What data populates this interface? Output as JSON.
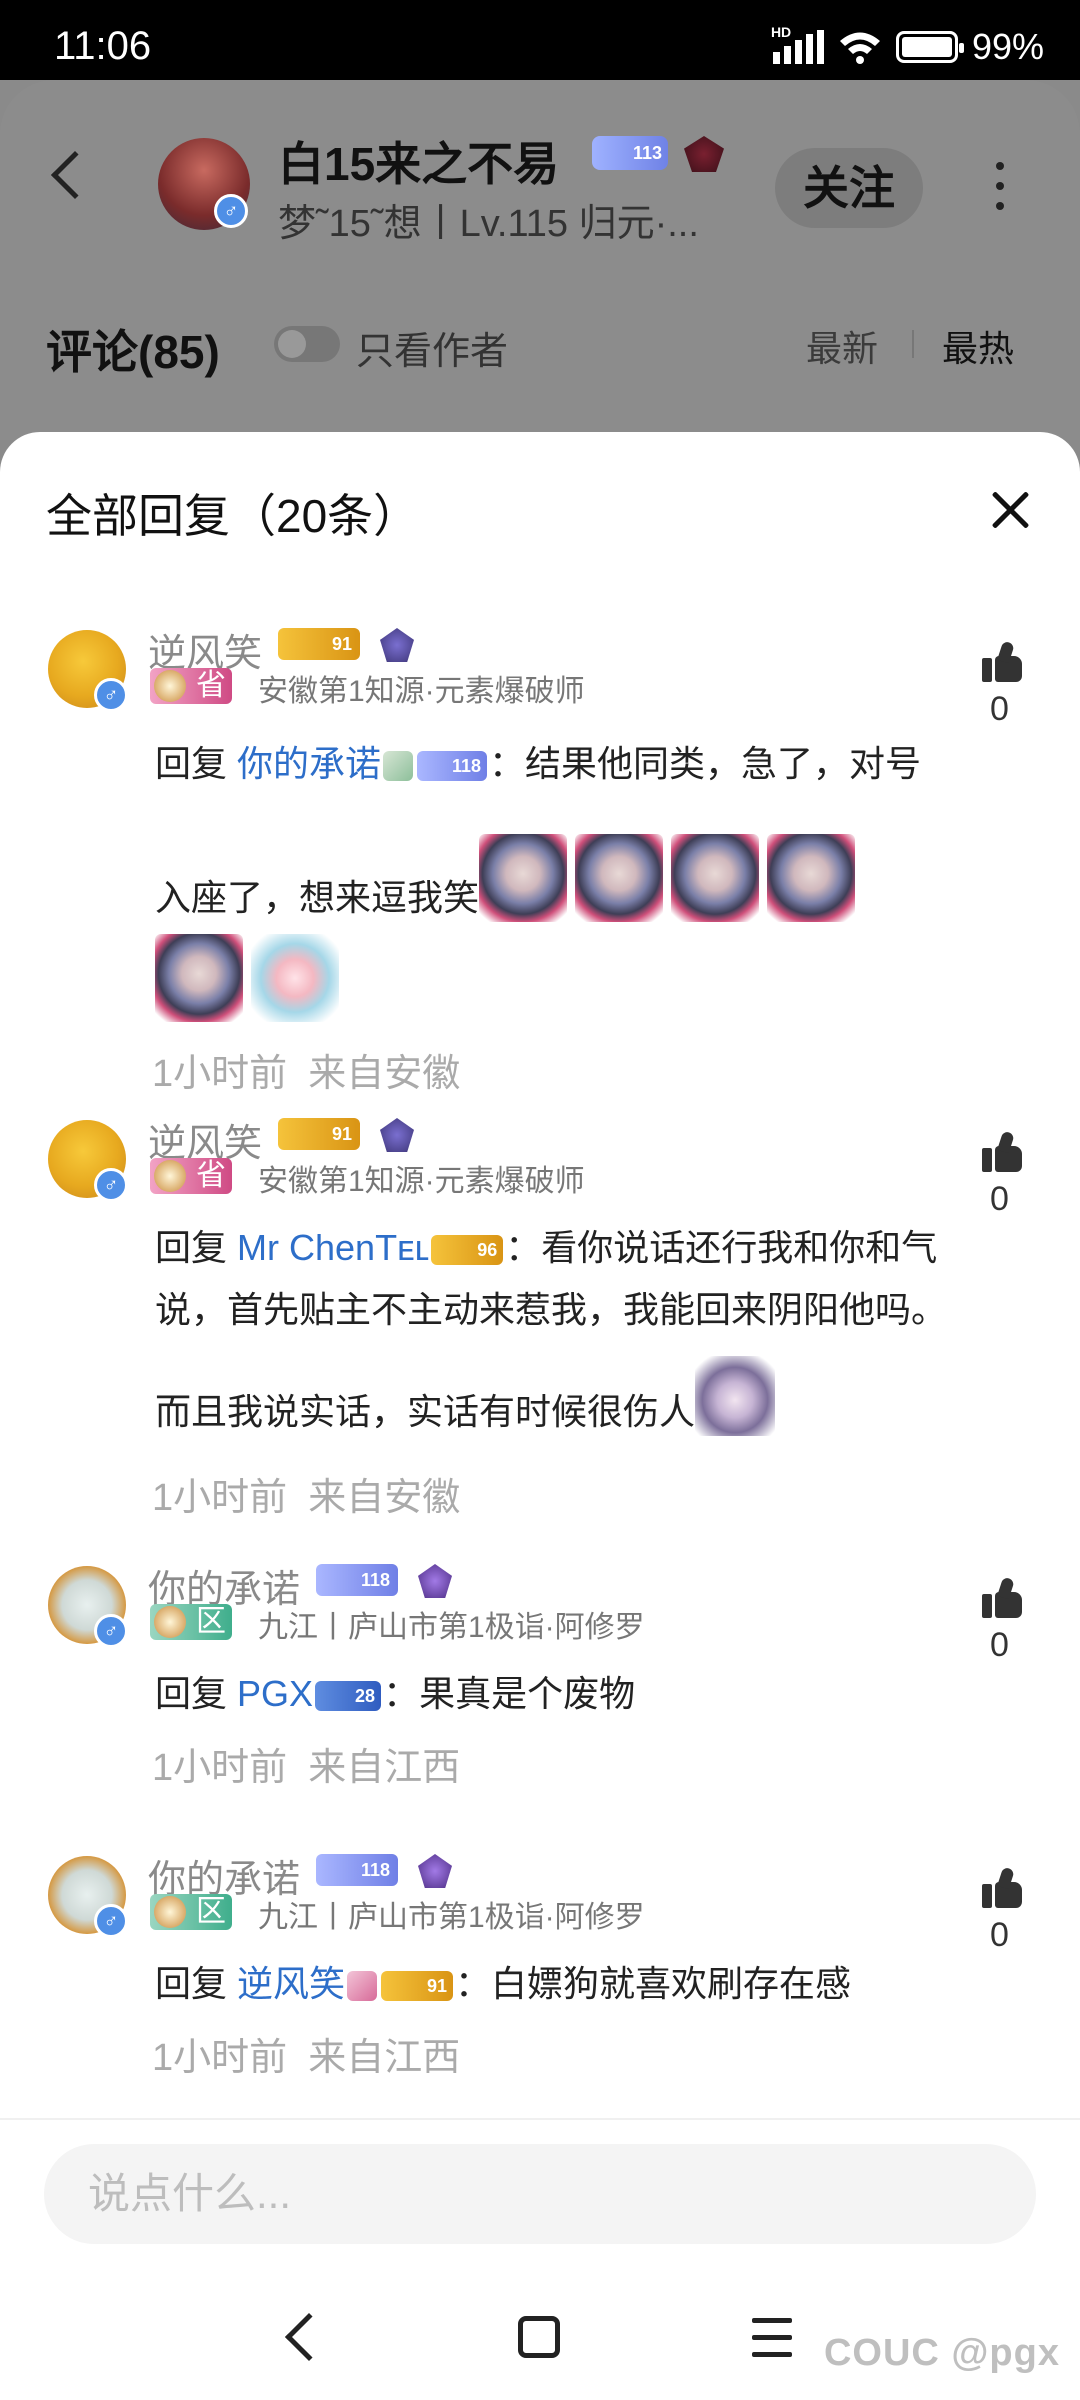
{
  "status_bar": {
    "time": "11:06",
    "battery": "99%",
    "network_label": "HD"
  },
  "background_page": {
    "author_name": "白15来之不易",
    "author_sub": "梦˜15˜想丨Lv.115 归元·...",
    "author_badge_level": "113",
    "follow_label": "关注",
    "comments_label": "评论(85)",
    "author_only_label": "只看作者",
    "sort_newest": "最新",
    "sort_hottest": "最热"
  },
  "sheet": {
    "title": "全部回复（20条）"
  },
  "replies": [
    {
      "name": "逆风笑",
      "crest_level": "91",
      "region_tag": "省",
      "location": "安徽第1知源·元素爆破师",
      "reply_kw": "回复",
      "mention": "你的承诺",
      "mention_badge": "118",
      "text_1": "：结果他同类，急了，对号",
      "text_2": "入座了，想来逗我笑",
      "time": "1小时前",
      "from": "来自安徽",
      "likes": "0"
    },
    {
      "name": "逆风笑",
      "crest_level": "91",
      "region_tag": "省",
      "location": "安徽第1知源·元素爆破师",
      "reply_kw": "回复",
      "mention": "Mr ChenTᴇʟ",
      "mention_badge": "96",
      "text_1": "：看你说话还行我和你和气",
      "text_2": "说，首先贴主不主动来惹我，我能回来阴阳他吗。",
      "text_3": "而且我说实话，实话有时候很伤人",
      "time": "1小时前",
      "from": "来自安徽",
      "likes": "0"
    },
    {
      "name": "你的承诺",
      "crest_level": "118",
      "region_tag": "区",
      "location": "九江丨庐山市第1极诣·阿修罗",
      "reply_kw": "回复",
      "mention": "PGX",
      "mention_badge": "28",
      "text_1": "：果真是个废物",
      "time": "1小时前",
      "from": "来自江西",
      "likes": "0"
    },
    {
      "name": "你的承诺",
      "crest_level": "118",
      "region_tag": "区",
      "location": "九江丨庐山市第1极诣·阿修罗",
      "reply_kw": "回复",
      "mention": "逆风笑",
      "mention_badge": "91",
      "text_1": "：白嫖狗就喜欢刷存在感",
      "time": "1小时前",
      "from": "来自江西",
      "likes": "0"
    }
  ],
  "input": {
    "placeholder": "说点什么..."
  },
  "watermark": "COUC @pgx",
  "colors": {
    "mention": "#2d6ec9",
    "meta": "#aaaaaa",
    "dim_overlay": "#8a8a8a"
  }
}
